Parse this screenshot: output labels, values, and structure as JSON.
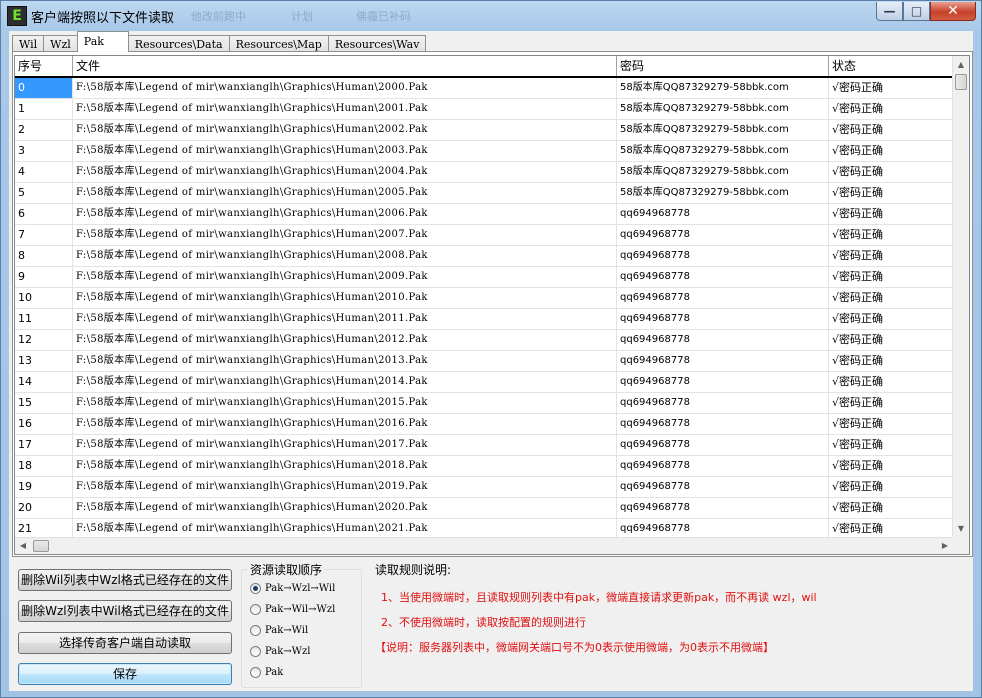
{
  "window": {
    "title": "客户端按照以下文件读取",
    "title_faint": [
      "他改前跑中",
      "计划",
      "佛霾已补码"
    ]
  },
  "tabs": [
    {
      "label": "Wil",
      "active": false
    },
    {
      "label": "Wzl",
      "active": false
    },
    {
      "label": "Pak",
      "active": true
    },
    {
      "label": "Resources\\Data",
      "active": false
    },
    {
      "label": "Resources\\Map",
      "active": false
    },
    {
      "label": "Resources\\Wav",
      "active": false
    }
  ],
  "grid": {
    "columns": [
      "序号",
      "文件",
      "密码",
      "状态"
    ],
    "rows": [
      [
        "0",
        "F:\\58版本库\\Legend of mir\\wanxianglh\\Graphics\\Human\\2000.Pak",
        "58版本库QQ87329279-58bbk.com",
        "√密码正确"
      ],
      [
        "1",
        "F:\\58版本库\\Legend of mir\\wanxianglh\\Graphics\\Human\\2001.Pak",
        "58版本库QQ87329279-58bbk.com",
        "√密码正确"
      ],
      [
        "2",
        "F:\\58版本库\\Legend of mir\\wanxianglh\\Graphics\\Human\\2002.Pak",
        "58版本库QQ87329279-58bbk.com",
        "√密码正确"
      ],
      [
        "3",
        "F:\\58版本库\\Legend of mir\\wanxianglh\\Graphics\\Human\\2003.Pak",
        "58版本库QQ87329279-58bbk.com",
        "√密码正确"
      ],
      [
        "4",
        "F:\\58版本库\\Legend of mir\\wanxianglh\\Graphics\\Human\\2004.Pak",
        "58版本库QQ87329279-58bbk.com",
        "√密码正确"
      ],
      [
        "5",
        "F:\\58版本库\\Legend of mir\\wanxianglh\\Graphics\\Human\\2005.Pak",
        "58版本库QQ87329279-58bbk.com",
        "√密码正确"
      ],
      [
        "6",
        "F:\\58版本库\\Legend of mir\\wanxianglh\\Graphics\\Human\\2006.Pak",
        "qq694968778",
        "√密码正确"
      ],
      [
        "7",
        "F:\\58版本库\\Legend of mir\\wanxianglh\\Graphics\\Human\\2007.Pak",
        "qq694968778",
        "√密码正确"
      ],
      [
        "8",
        "F:\\58版本库\\Legend of mir\\wanxianglh\\Graphics\\Human\\2008.Pak",
        "qq694968778",
        "√密码正确"
      ],
      [
        "9",
        "F:\\58版本库\\Legend of mir\\wanxianglh\\Graphics\\Human\\2009.Pak",
        "qq694968778",
        "√密码正确"
      ],
      [
        "10",
        "F:\\58版本库\\Legend of mir\\wanxianglh\\Graphics\\Human\\2010.Pak",
        "qq694968778",
        "√密码正确"
      ],
      [
        "11",
        "F:\\58版本库\\Legend of mir\\wanxianglh\\Graphics\\Human\\2011.Pak",
        "qq694968778",
        "√密码正确"
      ],
      [
        "12",
        "F:\\58版本库\\Legend of mir\\wanxianglh\\Graphics\\Human\\2012.Pak",
        "qq694968778",
        "√密码正确"
      ],
      [
        "13",
        "F:\\58版本库\\Legend of mir\\wanxianglh\\Graphics\\Human\\2013.Pak",
        "qq694968778",
        "√密码正确"
      ],
      [
        "14",
        "F:\\58版本库\\Legend of mir\\wanxianglh\\Graphics\\Human\\2014.Pak",
        "qq694968778",
        "√密码正确"
      ],
      [
        "15",
        "F:\\58版本库\\Legend of mir\\wanxianglh\\Graphics\\Human\\2015.Pak",
        "qq694968778",
        "√密码正确"
      ],
      [
        "16",
        "F:\\58版本库\\Legend of mir\\wanxianglh\\Graphics\\Human\\2016.Pak",
        "qq694968778",
        "√密码正确"
      ],
      [
        "17",
        "F:\\58版本库\\Legend of mir\\wanxianglh\\Graphics\\Human\\2017.Pak",
        "qq694968778",
        "√密码正确"
      ],
      [
        "18",
        "F:\\58版本库\\Legend of mir\\wanxianglh\\Graphics\\Human\\2018.Pak",
        "qq694968778",
        "√密码正确"
      ],
      [
        "19",
        "F:\\58版本库\\Legend of mir\\wanxianglh\\Graphics\\Human\\2019.Pak",
        "qq694968778",
        "√密码正确"
      ],
      [
        "20",
        "F:\\58版本库\\Legend of mir\\wanxianglh\\Graphics\\Human\\2020.Pak",
        "qq694968778",
        "√密码正确"
      ],
      [
        "21",
        "F:\\58版本库\\Legend of mir\\wanxianglh\\Graphics\\Human\\2021.Pak",
        "qq694968778",
        "√密码正确"
      ]
    ],
    "selected_row": 0
  },
  "buttons": {
    "delete_wil": "删除Wil列表中Wzl格式已经存在的文件",
    "delete_wzl": "删除Wzl列表中Wil格式已经存在的文件",
    "auto_read": "选择传奇客户端自动读取",
    "save": "保存"
  },
  "order_group": {
    "title": "资源读取顺序",
    "options": [
      "Pak→Wzl→Wil",
      "Pak→Wil→Wzl",
      "Pak→Wil",
      "Pak→Wzl",
      "Pak"
    ],
    "selected": 0
  },
  "rules": {
    "title": "读取规则说明:",
    "lines": [
      "1、当使用微端时，且读取规则列表中有pak，微端直接请求更新pak，而不再读 wzl，wil",
      "2、不使用微端时，读取按配置的规则进行",
      "【说明：服务器列表中，微端网关端口号不为0表示使用微端，为0表示不用微端】"
    ]
  }
}
